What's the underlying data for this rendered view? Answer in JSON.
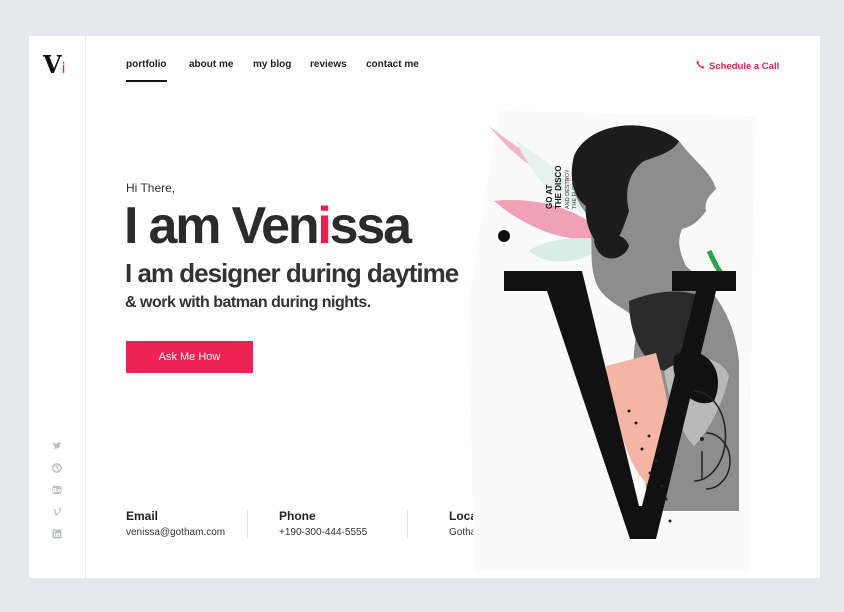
{
  "brand": {
    "letter": "V",
    "sub": "i"
  },
  "nav": [
    {
      "label": "portfolio"
    },
    {
      "label": "about me"
    },
    {
      "label": "my blog"
    },
    {
      "label": "reviews"
    },
    {
      "label": "contact me"
    }
  ],
  "header": {
    "cta": "Schedule a Call"
  },
  "hero": {
    "greeting": "Hi There,",
    "title_part1": "I am Ven",
    "title_i": "i",
    "title_part2": "ssa",
    "subtitle": "I am designer during daytime",
    "tagline": "& work with batman during nights.",
    "button": "Ask Me How"
  },
  "art": {
    "line1": "GO AT",
    "line2": "THE DISCO",
    "line3": "AND DESTROY",
    "line4": "THE FLOR"
  },
  "contact": {
    "email_label": "Email",
    "email": "venissa@gotham.com",
    "phone_label": "Phone",
    "phone": "+190-300-444-5555",
    "location_label": "Location",
    "location": "Gotham City, Arkham"
  },
  "social": [
    "twitter-icon",
    "dribbble-icon",
    "behance-icon",
    "vimeo-icon",
    "linkedin-icon"
  ],
  "colors": {
    "accent": "#ee2255",
    "background": "#e6e8ed"
  }
}
